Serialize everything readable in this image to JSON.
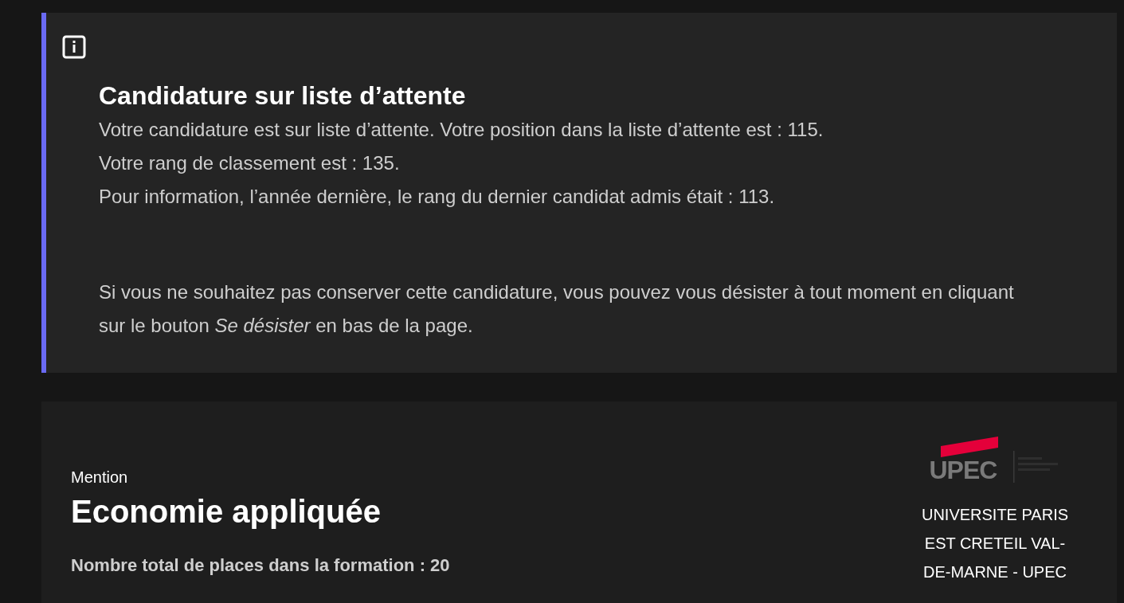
{
  "notice": {
    "title": "Candidature sur liste d’attente",
    "lines": [
      "Votre candidature est sur liste d’attente. Votre position dans la liste d’attente est : 115.",
      "Votre rang de classement est : 135.",
      "Pour information, l’année dernière, le rang du dernier candidat admis était : 113."
    ],
    "note": "Si vous ne souhaitez pas conserver cette candidature, vous pouvez vous désister à tout moment en cliquant sur le bouton *Se désister* en bas de la page."
  },
  "formation": {
    "label": "Mention",
    "title": "Economie appliquée",
    "places": "Nombre total de places dans la formation : 20",
    "logo": {
      "name": "UPEC"
    },
    "university": "UNIVERSITE PARIS EST CRETEIL VAL-DE-MARNE - UPEC"
  }
}
